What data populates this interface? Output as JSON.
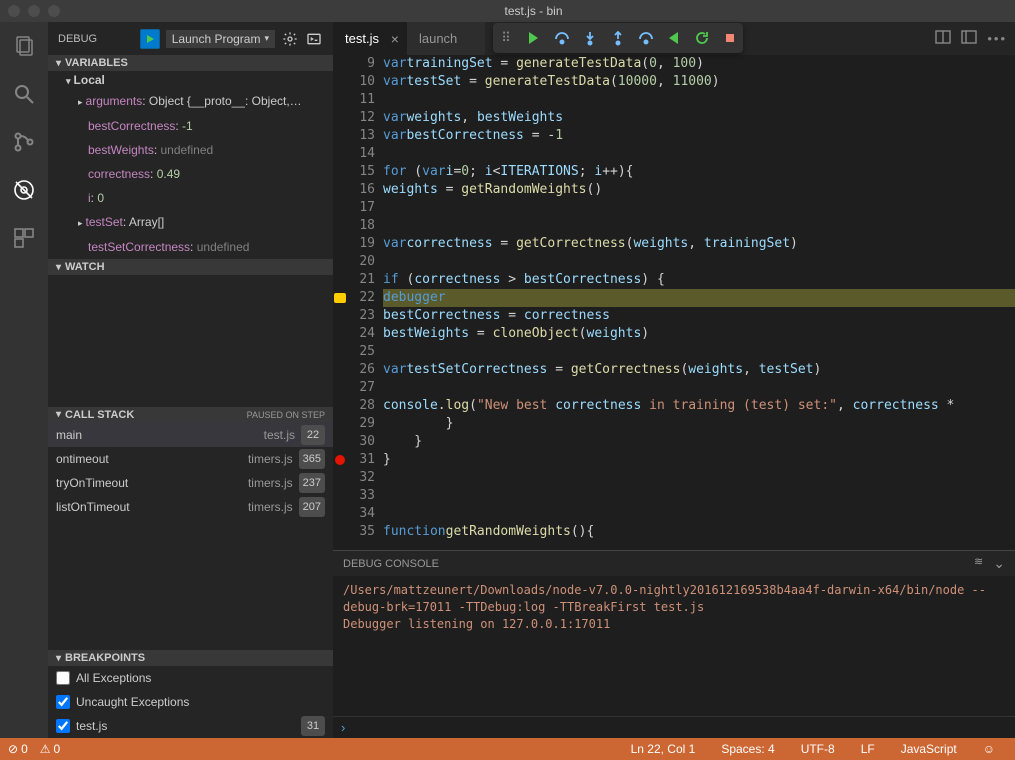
{
  "window": {
    "title": "test.js - bin"
  },
  "debug": {
    "title": "DEBUG",
    "config": "Launch Program",
    "sections": {
      "variables": "VARIABLES",
      "watch": "WATCH",
      "callstack": "CALL STACK",
      "callstack_status": "PAUSED ON STEP",
      "breakpoints": "BREAKPOINTS"
    },
    "scope": "Local",
    "variables": [
      {
        "name": "arguments",
        "value": "Object {__proto__: Object,…",
        "type": "obj",
        "expandable": true
      },
      {
        "name": "bestCorrectness",
        "value": "-1",
        "type": "num"
      },
      {
        "name": "bestWeights",
        "value": "undefined",
        "type": "undef"
      },
      {
        "name": "correctness",
        "value": "0.49",
        "type": "num"
      },
      {
        "name": "i",
        "value": "0",
        "type": "num"
      },
      {
        "name": "testSet",
        "value": "Array[]",
        "type": "obj",
        "expandable": true
      },
      {
        "name": "testSetCorrectness",
        "value": "undefined",
        "type": "undef"
      }
    ],
    "callstack": [
      {
        "fn": "main",
        "file": "test.js",
        "line": "22",
        "active": true
      },
      {
        "fn": "ontimeout",
        "file": "timers.js",
        "line": "365"
      },
      {
        "fn": "tryOnTimeout",
        "file": "timers.js",
        "line": "237"
      },
      {
        "fn": "listOnTimeout",
        "file": "timers.js",
        "line": "207"
      }
    ],
    "breakpoints": [
      {
        "label": "All Exceptions",
        "checked": false
      },
      {
        "label": "Uncaught Exceptions",
        "checked": true
      },
      {
        "label": "test.js",
        "checked": true,
        "badge": "31"
      }
    ]
  },
  "tabs": [
    {
      "label": "test.js",
      "active": true
    },
    {
      "label": "launch"
    }
  ],
  "code": {
    "start": 9,
    "highlight": 22,
    "breakpoint": 31,
    "lines": [
      "    var trainingSet = generateTestData(0, 100)",
      "    var testSet = generateTestData(10000, 11000)",
      "",
      "    var weights, bestWeights",
      "    var bestCorrectness = -1",
      "",
      "    for (var i=0; i<ITERATIONS; i++){",
      "        weights = getRandomWeights()",
      "",
      "",
      "        var correctness = getCorrectness(weights, trainingSet)",
      "",
      "        if (correctness > bestCorrectness) {",
      "            debugger",
      "            bestCorrectness = correctness",
      "            bestWeights = cloneObject(weights)",
      "",
      "            var testSetCorrectness = getCorrectness(weights, testSet)",
      "",
      "            console.log(\"New best correctness in training (test) set:\", correctness *",
      "        }",
      "    }",
      "}",
      "",
      "",
      "",
      "function getRandomWeights(){"
    ]
  },
  "debugConsole": {
    "title": "DEBUG CONSOLE",
    "lines": [
      "/Users/mattzeunert/Downloads/node-v7.0.0-nightly201612169538b4aa4f-darwin-x64/bin/node --debug-brk=17011 -TTDebug:log -TTBreakFirst test.js",
      "Debugger listening on 127.0.0.1:17011"
    ]
  },
  "status": {
    "errors": "0",
    "warnings": "0",
    "position": "Ln 22, Col 1",
    "spaces": "Spaces: 4",
    "encoding": "UTF-8",
    "eol": "LF",
    "lang": "JavaScript"
  }
}
